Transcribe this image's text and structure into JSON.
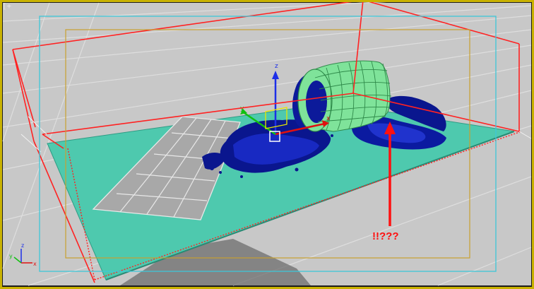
{
  "viewport": {
    "label": "[+",
    "background": "#c8c8c8",
    "outer_frame": "#e6c800"
  },
  "gizmo": {
    "z_label": "z",
    "x_label": "x",
    "y_label": "y"
  },
  "world_axis": {
    "z_label": "z",
    "x_label": "x",
    "y_label": "y"
  },
  "annotation": {
    "text": "!!???",
    "color": "#ff1010"
  },
  "colors": {
    "container_box": "#ff2222",
    "ground_plane": "#4ec9ae",
    "fluid": "#0b1aa0",
    "pipe": "#7fe39a",
    "safe_frame_outer": "#3fc7d8",
    "safe_frame_inner": "#c8a030",
    "grid_lines": "#dcdcdc",
    "plane_object": "#a6a6a6"
  }
}
